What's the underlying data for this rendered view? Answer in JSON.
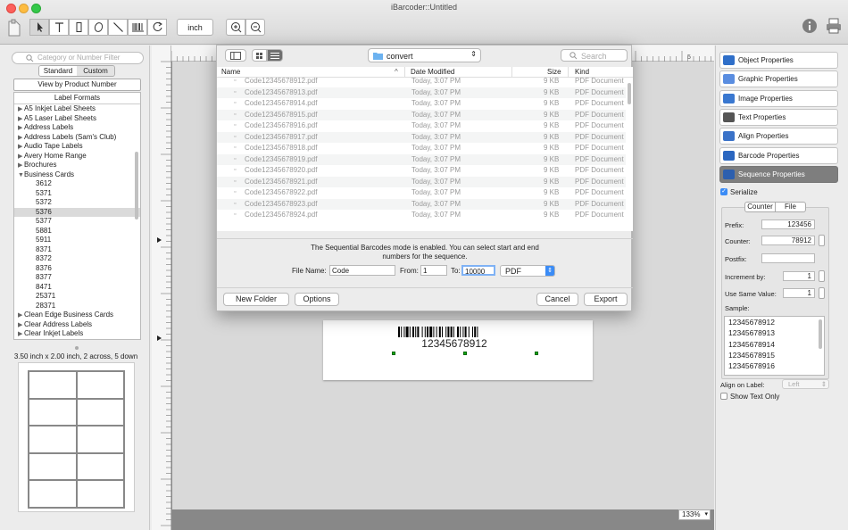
{
  "window": {
    "title": "iBarcoder::Untitled",
    "unit_button": "inch"
  },
  "left_panel": {
    "search_placeholder": "Category or Number Filter",
    "tabs": [
      "Standard",
      "Custom"
    ],
    "selected_tab": "Custom",
    "view_button": "View by Product Number",
    "list_header": "Label Formats",
    "items": [
      {
        "label": "A5 Inkjet Label Sheets",
        "type": "group",
        "open": false
      },
      {
        "label": "A5 Laser Label Sheets",
        "type": "group",
        "open": false
      },
      {
        "label": "Address Labels",
        "type": "group",
        "open": false
      },
      {
        "label": "Address Labels (Sam's Club)",
        "type": "group",
        "open": false
      },
      {
        "label": "Audio Tape Labels",
        "type": "group",
        "open": false
      },
      {
        "label": "Avery Home Range",
        "type": "group",
        "open": false
      },
      {
        "label": "Brochures",
        "type": "group",
        "open": false
      },
      {
        "label": "Business Cards",
        "type": "group",
        "open": true
      },
      {
        "label": "3612",
        "type": "item"
      },
      {
        "label": "5371",
        "type": "item"
      },
      {
        "label": "5372",
        "type": "item"
      },
      {
        "label": "5376",
        "type": "item",
        "selected": true
      },
      {
        "label": "5377",
        "type": "item"
      },
      {
        "label": "5881",
        "type": "item"
      },
      {
        "label": "5911",
        "type": "item"
      },
      {
        "label": "8371",
        "type": "item"
      },
      {
        "label": "8372",
        "type": "item"
      },
      {
        "label": "8376",
        "type": "item"
      },
      {
        "label": "8377",
        "type": "item"
      },
      {
        "label": "8471",
        "type": "item"
      },
      {
        "label": "25371",
        "type": "item"
      },
      {
        "label": "28371",
        "type": "item"
      },
      {
        "label": "Clean Edge  Business Cards",
        "type": "group",
        "open": false
      },
      {
        "label": "Clear Address Labels",
        "type": "group",
        "open": false
      },
      {
        "label": "Clear Inkjet Labels",
        "type": "group",
        "open": false
      }
    ],
    "label_info": "3.50 inch x 2.00 inch, 2 across, 5 down",
    "preview": {
      "across": 2,
      "down": 5
    }
  },
  "canvas": {
    "barcode_text": "12345678912",
    "zoom": "133%",
    "ruler_top_label": "5"
  },
  "dialog": {
    "folder": "convert",
    "search_placeholder": "Search",
    "columns": [
      "Name",
      "Date Modified",
      "Size",
      "Kind"
    ],
    "files": [
      {
        "name": "Code12345678912.pdf",
        "date": "Today, 3:07 PM",
        "size": "9 KB",
        "kind": "PDF Document"
      },
      {
        "name": "Code12345678913.pdf",
        "date": "Today, 3:07 PM",
        "size": "9 KB",
        "kind": "PDF Document"
      },
      {
        "name": "Code12345678914.pdf",
        "date": "Today, 3:07 PM",
        "size": "9 KB",
        "kind": "PDF Document"
      },
      {
        "name": "Code12345678915.pdf",
        "date": "Today, 3:07 PM",
        "size": "9 KB",
        "kind": "PDF Document"
      },
      {
        "name": "Code12345678916.pdf",
        "date": "Today, 3:07 PM",
        "size": "9 KB",
        "kind": "PDF Document"
      },
      {
        "name": "Code12345678917.pdf",
        "date": "Today, 3:07 PM",
        "size": "9 KB",
        "kind": "PDF Document"
      },
      {
        "name": "Code12345678918.pdf",
        "date": "Today, 3:07 PM",
        "size": "9 KB",
        "kind": "PDF Document"
      },
      {
        "name": "Code12345678919.pdf",
        "date": "Today, 3:07 PM",
        "size": "9 KB",
        "kind": "PDF Document"
      },
      {
        "name": "Code12345678920.pdf",
        "date": "Today, 3:07 PM",
        "size": "9 KB",
        "kind": "PDF Document"
      },
      {
        "name": "Code12345678921.pdf",
        "date": "Today, 3:07 PM",
        "size": "9 KB",
        "kind": "PDF Document"
      },
      {
        "name": "Code12345678922.pdf",
        "date": "Today, 3:07 PM",
        "size": "9 KB",
        "kind": "PDF Document"
      },
      {
        "name": "Code12345678923.pdf",
        "date": "Today, 3:07 PM",
        "size": "9 KB",
        "kind": "PDF Document"
      },
      {
        "name": "Code12345678924.pdf",
        "date": "Today, 3:07 PM",
        "size": "9 KB",
        "kind": "PDF Document"
      }
    ],
    "message": "The Sequential Barcodes mode is enabled. You can select start and end numbers for the sequence.",
    "file_name_label": "File Name:",
    "file_name": "Code",
    "from_label": "From:",
    "from_value": "1",
    "to_label": "To:",
    "to_value": "10000",
    "format": "PDF",
    "new_folder": "New Folder",
    "options": "Options",
    "cancel": "Cancel",
    "export": "Export"
  },
  "right_panel": {
    "buttons": [
      {
        "label": "Object Properties",
        "icon": "object-icon"
      },
      {
        "label": "Graphic Properties",
        "icon": "graphic-icon"
      },
      {
        "label": "Image Properties",
        "icon": "image-icon"
      },
      {
        "label": "Text Properties",
        "icon": "text-icon"
      },
      {
        "label": "Align Properties",
        "icon": "align-icon"
      },
      {
        "label": "Barcode Properties",
        "icon": "barcode-icon"
      },
      {
        "label": "Sequence Properties",
        "icon": "sequence-icon",
        "selected": true
      }
    ],
    "serialize_label": "Serialize",
    "serialize": true,
    "tabs": [
      "Counter",
      "File"
    ],
    "prefix_label": "Prefix:",
    "prefix": "123456",
    "counter_label": "Counter:",
    "counter": "78912",
    "postfix_label": "Postfix:",
    "postfix": "",
    "increment_label": "Increment by:",
    "increment": "1",
    "same_value_label": "Use Same Value:",
    "same_value": "1",
    "sample_label": "Sample:",
    "samples": [
      "12345678912",
      "12345678913",
      "12345678914",
      "12345678915",
      "12345678916"
    ],
    "align_label": "Align on Label:",
    "align_value": "Left",
    "show_text_only_label": "Show Text Only",
    "show_text_only": false
  },
  "colors": {
    "accent": "#3b8cf6",
    "selected_panel": "#7e7e7e",
    "export_highlight": "#3b8cf6"
  }
}
